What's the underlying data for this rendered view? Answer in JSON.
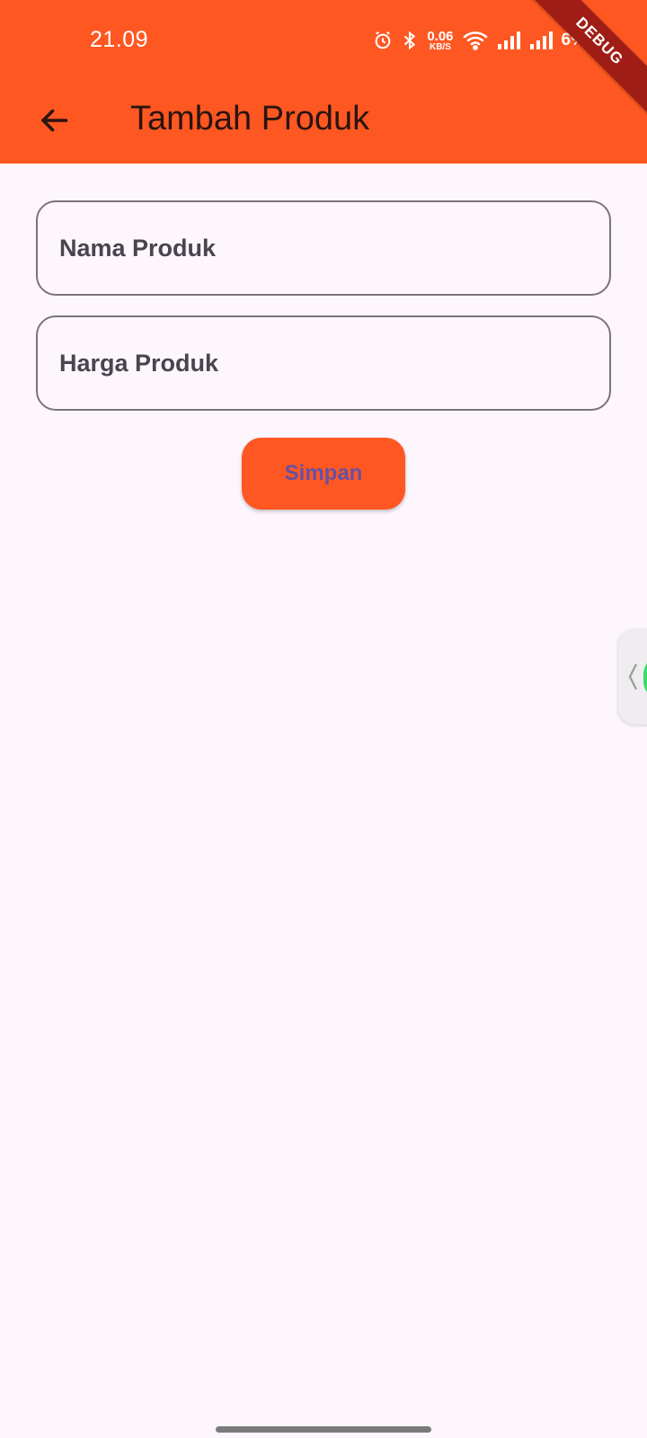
{
  "status_bar": {
    "time": "21.09",
    "net_speed_value": "0.06",
    "net_speed_unit": "KB/S",
    "battery": "6%",
    "icons": [
      "alarm-icon",
      "bluetooth-icon",
      "wifi-icon",
      "signal-icon",
      "signal-icon"
    ]
  },
  "app_bar": {
    "title": "Tambah Produk",
    "back_icon": "arrow-left-icon",
    "background": "#FF5722"
  },
  "debug_banner": "DEBUG",
  "form": {
    "name_placeholder": "Nama Produk",
    "name_value": "",
    "price_placeholder": "Harga Produk",
    "price_value": "",
    "save_label": "Simpan"
  },
  "colors": {
    "accent": "#FF5722",
    "button_text": "#6750A4",
    "background": "#FDF7FD"
  }
}
